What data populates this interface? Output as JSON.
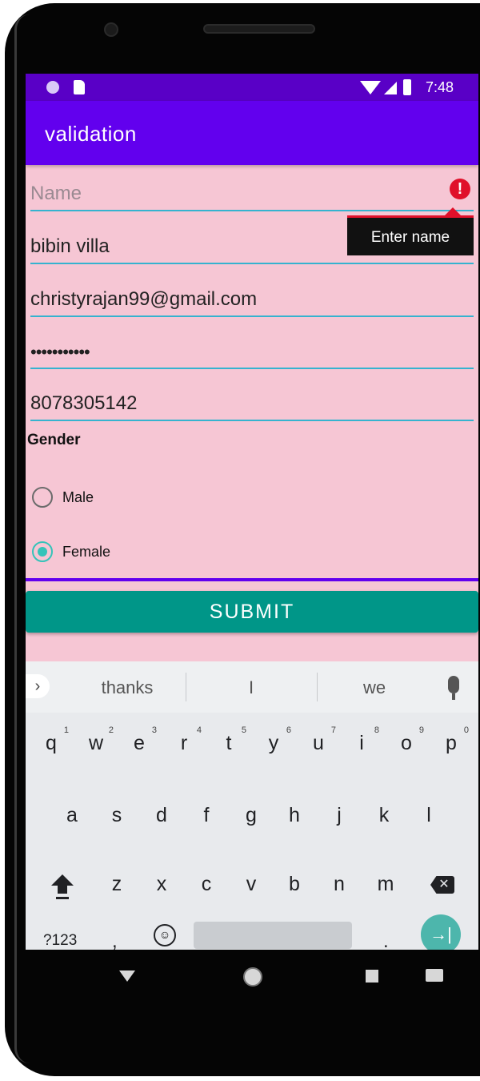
{
  "status_bar": {
    "time": "7:48"
  },
  "app": {
    "title": "validation"
  },
  "form": {
    "name": {
      "value": "",
      "placeholder": "Name",
      "error": "Enter name"
    },
    "address": {
      "value": "bibin villa"
    },
    "email": {
      "value": "christyrajan99@gmail.com"
    },
    "password": {
      "value": "•••••••••••"
    },
    "phone": {
      "value": "8078305142"
    },
    "gender": {
      "label": "Gender",
      "options": [
        {
          "label": "Male",
          "selected": false
        },
        {
          "label": "Female",
          "selected": true
        }
      ]
    },
    "submit_label": "SUBMIT"
  },
  "keyboard": {
    "suggestions": [
      "thanks",
      "I",
      "we"
    ],
    "row1": [
      "q",
      "w",
      "e",
      "r",
      "t",
      "y",
      "u",
      "i",
      "o",
      "p"
    ],
    "row1_digits": [
      "1",
      "2",
      "3",
      "4",
      "5",
      "6",
      "7",
      "8",
      "9",
      "0"
    ],
    "row2": [
      "a",
      "s",
      "d",
      "f",
      "g",
      "h",
      "j",
      "k",
      "l"
    ],
    "row3": [
      "z",
      "x",
      "c",
      "v",
      "b",
      "n",
      "m"
    ],
    "symbols_key": "?123",
    "comma": ",",
    "period": "."
  },
  "colors": {
    "primary": "#6200ee",
    "status_bar": "#5900c6",
    "background": "#f6c6d4",
    "accent_line": "#35b3cf",
    "submit": "#009688",
    "radio_checked": "#35c3b9",
    "error": "#e0102a"
  },
  "icons": [
    "error-icon",
    "wifi-icon",
    "signal-icon",
    "battery-icon",
    "mic-icon",
    "shift-icon",
    "backspace-icon",
    "emoji-icon",
    "enter-icon",
    "back-icon",
    "home-icon",
    "recents-icon",
    "keyboard-icon"
  ]
}
